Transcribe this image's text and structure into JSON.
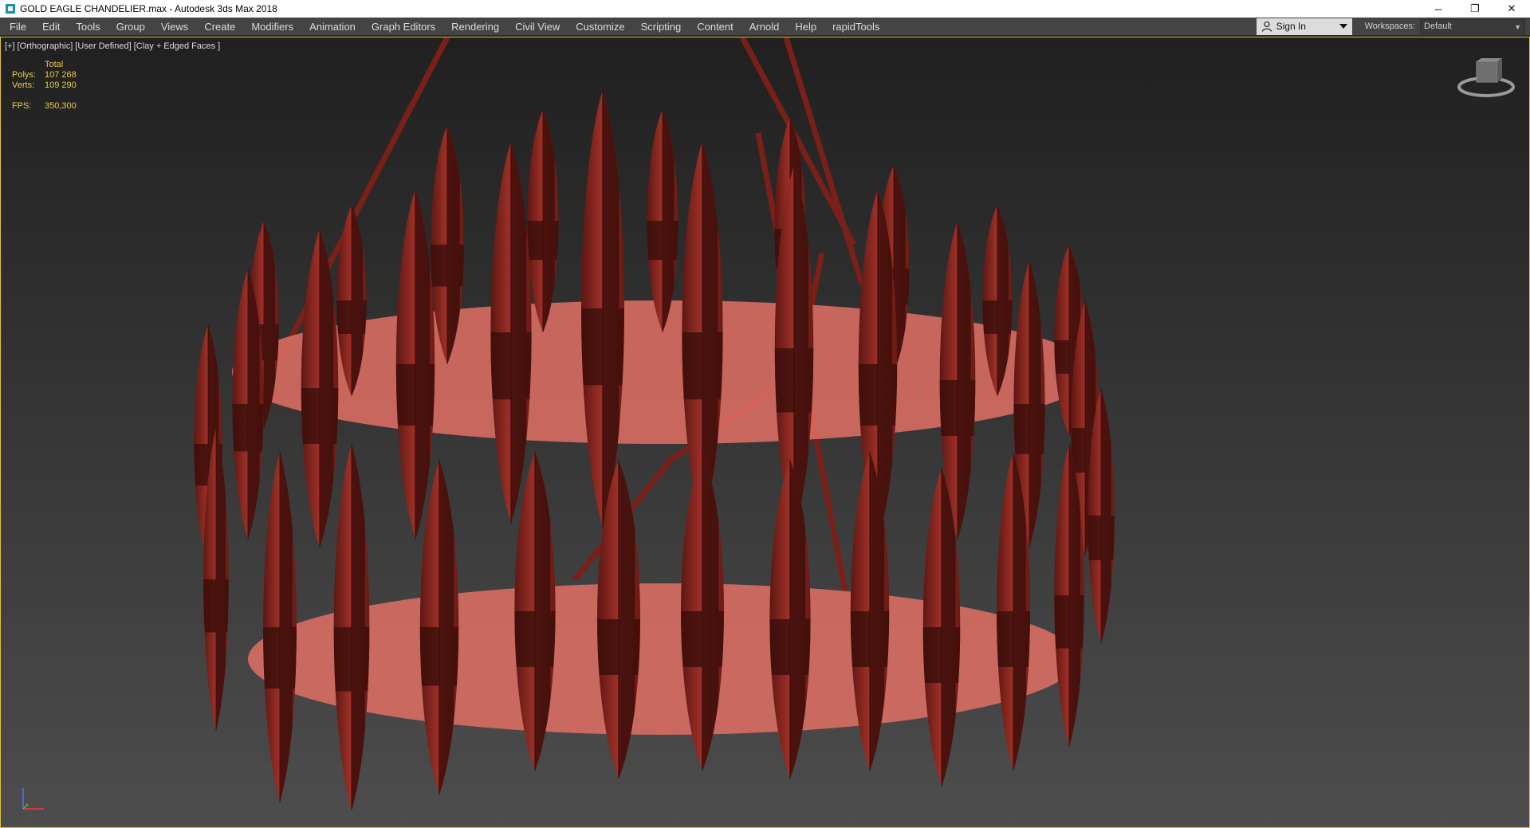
{
  "window": {
    "title": "GOLD EAGLE CHANDELIER.max - Autodesk 3ds Max 2018",
    "minimize_glyph": "─",
    "restore_glyph": "❐",
    "close_glyph": "✕"
  },
  "menu": [
    "File",
    "Edit",
    "Tools",
    "Group",
    "Views",
    "Create",
    "Modifiers",
    "Animation",
    "Graph Editors",
    "Rendering",
    "Civil View",
    "Customize",
    "Scripting",
    "Content",
    "Arnold",
    "Help",
    "rapidTools"
  ],
  "account": {
    "sign_in": "Sign In",
    "icon": "user-icon"
  },
  "workspace": {
    "label": "Workspaces:",
    "value": "Default"
  },
  "viewport": {
    "label": "[+] [Orthographic] [User Defined] [Clay + Edged Faces ]",
    "stats": {
      "header": "Total",
      "polys_label": "Polys:",
      "polys_value": "107 268",
      "verts_label": "Verts:",
      "verts_value": "109 290",
      "fps_label": "FPS:",
      "fps_value": "350,300"
    }
  },
  "colors": {
    "accent": "#e8c84c",
    "mesh_fill": "#8a2a22",
    "mesh_light": "#c9544a",
    "wire": "#3a0d0a",
    "ring_pink": "#e07064"
  }
}
